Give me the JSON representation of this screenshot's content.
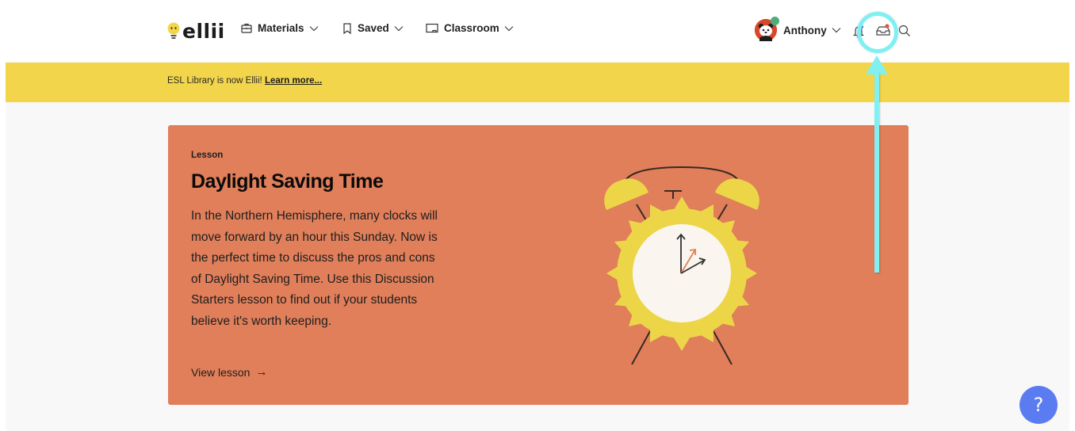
{
  "header": {
    "logo_text": "ellii",
    "nav": [
      {
        "label": "Materials",
        "icon": "briefcase-icon"
      },
      {
        "label": "Saved",
        "icon": "bookmark-icon"
      },
      {
        "label": "Classroom",
        "icon": "chalkboard-icon"
      }
    ],
    "user": {
      "name": "Anthony",
      "status_color": "#4caf7a"
    },
    "icons": [
      "bell-icon",
      "inbox-icon",
      "search-icon"
    ],
    "inbox_badge_color": "#e3553f"
  },
  "banner": {
    "text": "ESL Library is now Ellii! ",
    "link": "Learn more..."
  },
  "feature": {
    "kicker": "Lesson",
    "title": "Daylight Saving Time",
    "body": "In the Northern Hemisphere, many clocks will move forward by an hour this Sunday. Now is the perfect time to discuss the pros and cons of Daylight Saving Time. Use this Discussion Starters lesson to find out if your students believe it's worth keeping.",
    "link": "View lesson",
    "link_arrow": "→"
  },
  "help": {
    "label": "?"
  },
  "colors": {
    "banner": "#f2d54a",
    "card": "#e07f5a",
    "highlight": "#7ef0f2",
    "help": "#5b7cf0"
  }
}
